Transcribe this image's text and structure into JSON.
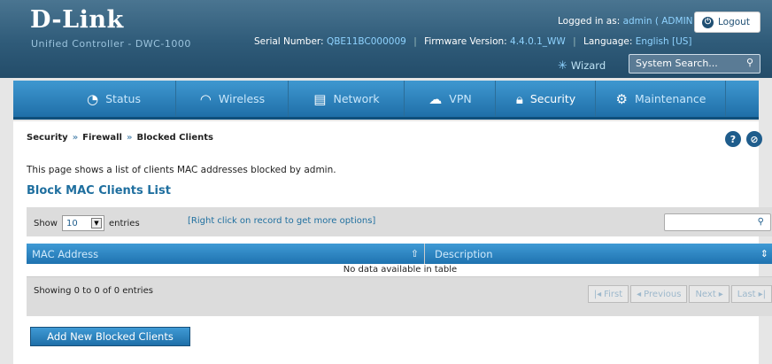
{
  "header": {
    "logo": "D-Link",
    "subtitle": "Unified Controller - DWC-1000",
    "logged_prefix": "Logged in as:",
    "logged_user": "admin ( ADMIN )",
    "logout_label": "Logout",
    "serial_label": "Serial Number:",
    "serial_value": "QBE11BC000009",
    "firmware_label": "Firmware Version:",
    "firmware_value": "4.4.0.1_WW",
    "language_label": "Language:",
    "language_value": "English [US]",
    "wizard_label": "Wizard",
    "search_placeholder": "System Search..."
  },
  "nav": {
    "items": [
      {
        "label": "Status",
        "icon": "gauge-icon"
      },
      {
        "label": "Wireless",
        "icon": "wifi-icon"
      },
      {
        "label": "Network",
        "icon": "monitor-icon"
      },
      {
        "label": "VPN",
        "icon": "cloud-lock-icon"
      },
      {
        "label": "Security",
        "icon": "lock-icon"
      },
      {
        "label": "Maintenance",
        "icon": "gears-icon"
      }
    ],
    "active": "Security"
  },
  "breadcrumb": [
    "Security",
    "Firewall",
    "Blocked Clients"
  ],
  "page": {
    "description": "This page shows a list of clients MAC addresses blocked by admin.",
    "section_title": "Block MAC Clients List"
  },
  "table": {
    "show_label": "Show",
    "entries_value": "10",
    "entries_label": "entries",
    "hint": "[Right click on record to get more options]",
    "columns": [
      "MAC Address",
      "Description"
    ],
    "empty_message": "No data available in table",
    "info": "Showing 0 to 0 of 0 entries",
    "pager": {
      "first": "First",
      "previous": "Previous",
      "next": "Next",
      "last": "Last"
    }
  },
  "actions": {
    "add_label": "Add New Blocked Clients"
  }
}
